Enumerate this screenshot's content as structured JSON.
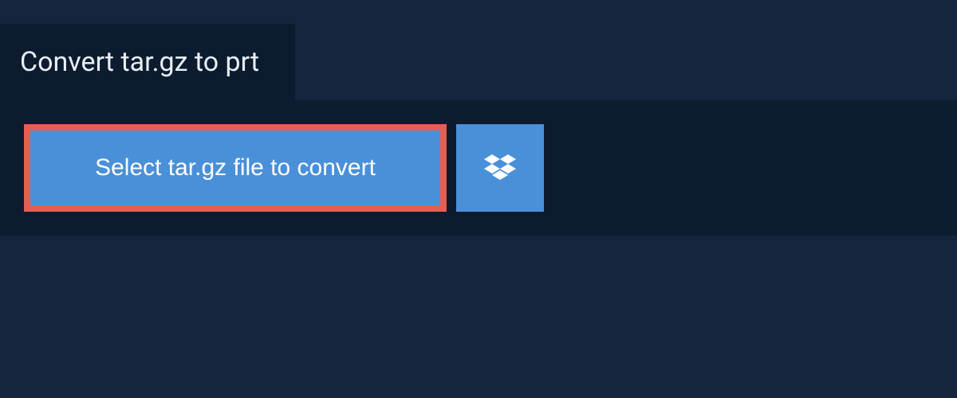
{
  "header": {
    "title": "Convert tar.gz to prt"
  },
  "actions": {
    "select_file_label": "Select tar.gz file to convert"
  },
  "colors": {
    "background": "#15253d",
    "panel": "#0d1b2e",
    "button": "#4a90d9",
    "highlight_border": "#e35f55",
    "text_light": "#e8eef5"
  }
}
